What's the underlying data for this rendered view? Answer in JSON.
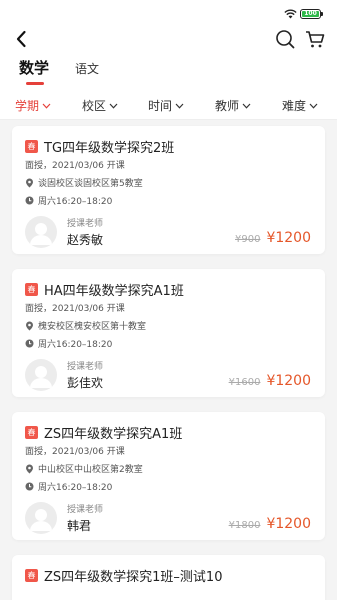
{
  "status_bar": {
    "battery": "100"
  },
  "icons": {
    "back": "chevron-left-icon",
    "search": "search-icon",
    "cart": "cart-icon"
  },
  "subject_tabs": [
    {
      "label": "数学",
      "active": true
    },
    {
      "label": "语文",
      "active": false
    }
  ],
  "filters": [
    {
      "label": "学期",
      "active": true
    },
    {
      "label": "校区",
      "active": false
    },
    {
      "label": "时间",
      "active": false
    },
    {
      "label": "教师",
      "active": false
    },
    {
      "label": "难度",
      "active": false
    }
  ],
  "colors": {
    "accent": "#e5403a",
    "price": "#e5572a",
    "badge": "#f0574a",
    "battery": "#2fb84a"
  },
  "courses": [
    {
      "badge": "春",
      "title": "TG四年级数学探究2班",
      "mode_date": "面授，2021/03/06 开课",
      "location": "谈固校区谈固校区第5教室",
      "time": "周六16:20–18:20",
      "teacher_label": "授课老师",
      "teacher_name": "赵秀敏",
      "old_price": "¥900",
      "price": "¥1200"
    },
    {
      "badge": "春",
      "title": "HA四年级数学探究A1班",
      "mode_date": "面授，2021/03/06 开课",
      "location": "槐安校区槐安校区第十教室",
      "time": "周六16:20–18:20",
      "teacher_label": "授课老师",
      "teacher_name": "彭佳欢",
      "old_price": "¥1600",
      "price": "¥1200"
    },
    {
      "badge": "春",
      "title": "ZS四年级数学探究A1班",
      "mode_date": "面授，2021/03/06 开课",
      "location": "中山校区中山校区第2教室",
      "time": "周六16:20–18:20",
      "teacher_label": "授课老师",
      "teacher_name": "韩君",
      "old_price": "¥1800",
      "price": "¥1200"
    },
    {
      "badge": "春",
      "title": "ZS四年级数学探究1班–测试10"
    }
  ]
}
